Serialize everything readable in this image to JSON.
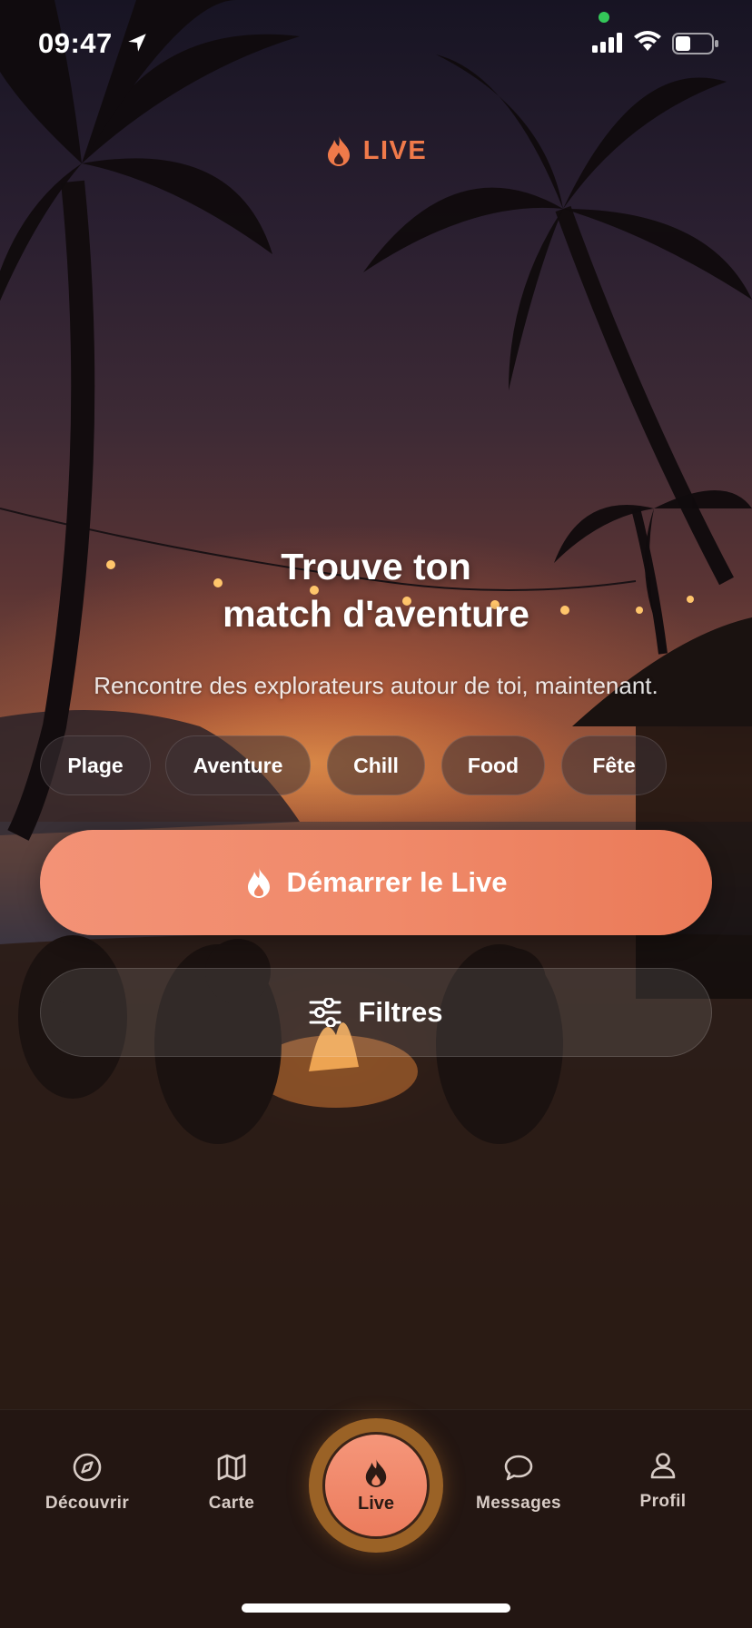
{
  "status_bar": {
    "time": "09:47"
  },
  "header": {
    "live_label": "LIVE"
  },
  "hero": {
    "title_line1": "Trouve ton",
    "title_line2": "match d'aventure",
    "subtitle": "Rencontre des explorateurs autour de toi, maintenant."
  },
  "chips": [
    "Plage",
    "Aventure",
    "Chill",
    "Food",
    "Fête"
  ],
  "actions": {
    "start_label": "Démarrer le Live",
    "filters_label": "Filtres"
  },
  "tabs": {
    "discover": "Découvrir",
    "map": "Carte",
    "live": "Live",
    "messages": "Messages",
    "profile": "Profil"
  },
  "colors": {
    "accent": "#f08a6a",
    "live_text": "#f07a4a",
    "tabbar_bg": "#231612"
  }
}
